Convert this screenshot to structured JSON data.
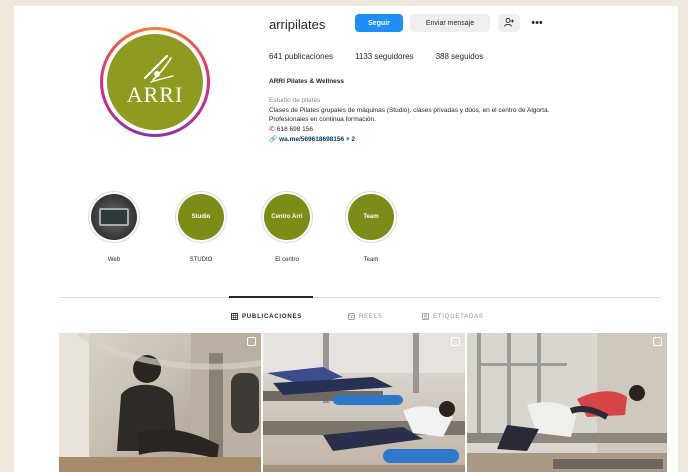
{
  "profile": {
    "username": "arripilates",
    "follow_label": "Seguir",
    "message_label": "Enviar mensaje",
    "more_label": "•••",
    "stats": {
      "posts": "641 publicaciones",
      "followers": "1133 seguidores",
      "following": "388 seguidos"
    },
    "full_name": "ARRI Pilates & Wellness",
    "category": "Estudio de pilates",
    "bio_line1": "Clases de Pilates grupales de máquinas (Studio), clases privadas y dúos, en el centro de Algorta.",
    "bio_line2": "Profesionales en continua formación.",
    "phone": "618 698 156",
    "link": "wa.me/56961869815​6 + 2",
    "avatar_logo": "ARRI"
  },
  "highlights": [
    {
      "label": "Web",
      "disc_text": ""
    },
    {
      "label": "STUDIO",
      "disc_text": "Studio"
    },
    {
      "label": "El centro",
      "disc_text": "Centro Arri"
    },
    {
      "label": "Team",
      "disc_text": "Team"
    }
  ],
  "tabs": [
    {
      "label": "PUBLICACIONES",
      "icon": "grid-icon"
    },
    {
      "label": "REELS",
      "icon": "reels-icon"
    },
    {
      "label": "ETIQUETADAS",
      "icon": "tagged-icon"
    }
  ],
  "colors": {
    "brand_olive": "#7c8c17",
    "follow_blue": "#1e8ff7",
    "link_blue": "#00376b"
  }
}
